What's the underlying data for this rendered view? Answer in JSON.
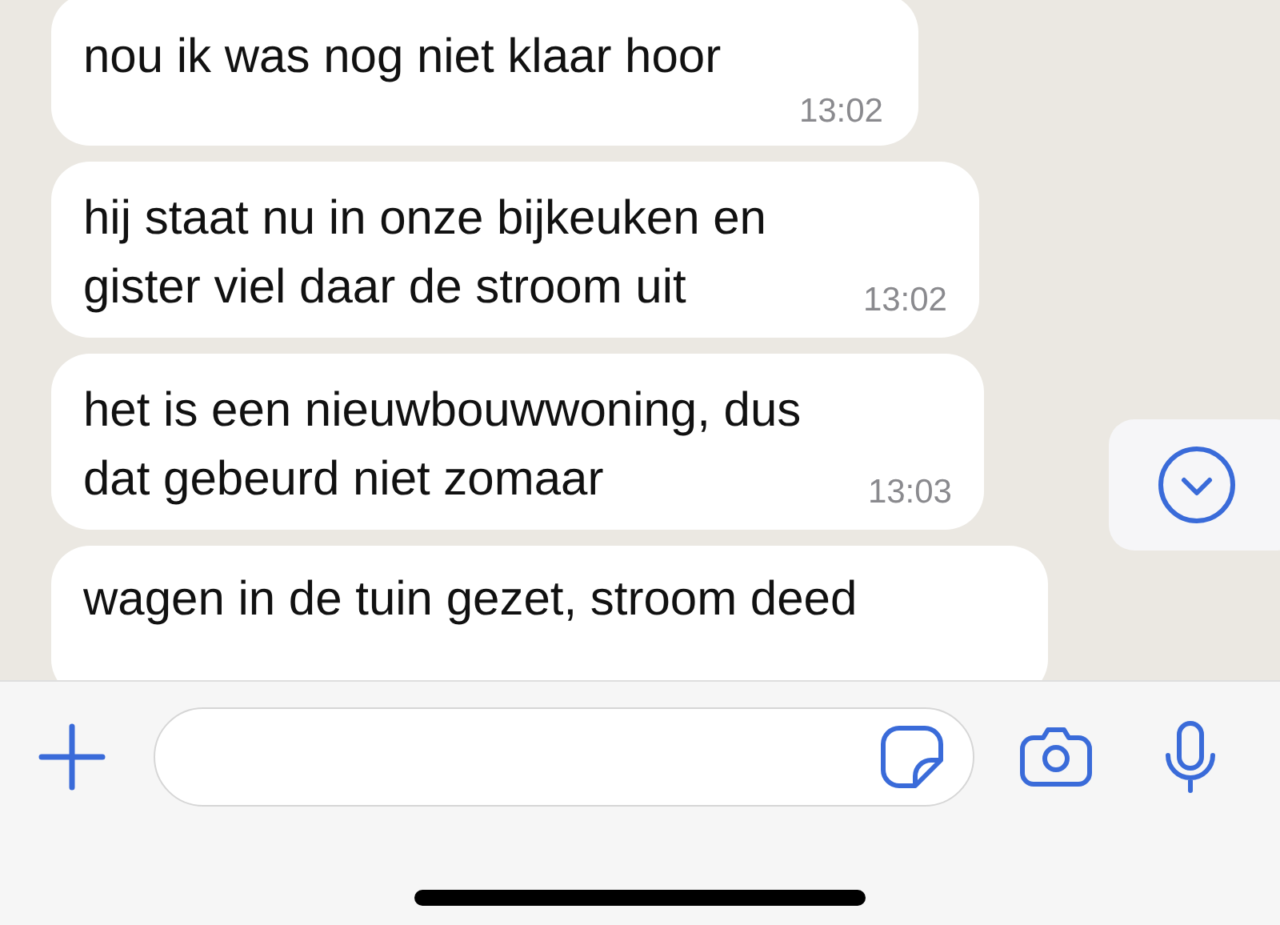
{
  "messages": [
    {
      "kind": "stacked",
      "text": "nou ik was nog niet klaar hoor",
      "time": "13:02"
    },
    {
      "kind": "inline",
      "text": "hij staat nu in onze bijkeuken en gister viel daar de stroom uit",
      "time": "13:02"
    },
    {
      "kind": "inline",
      "text": "het is een nieuwbouwwoning, dus dat gebeurd niet zomaar",
      "time": "13:03"
    },
    {
      "kind": "cut",
      "text": "wagen in de tuin gezet, stroom deed"
    }
  ]
}
